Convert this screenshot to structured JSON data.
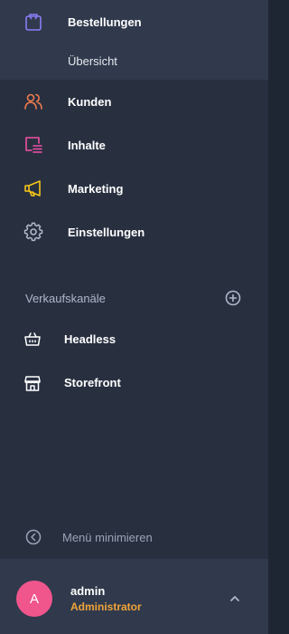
{
  "nav": {
    "orders": {
      "label": "Bestellungen",
      "icon": "shopping-bag-icon",
      "color": "#8b7cf6"
    },
    "orders_overview": {
      "label": "Übersicht"
    },
    "customers": {
      "label": "Kunden",
      "icon": "users-icon",
      "color": "#f07a4c"
    },
    "content": {
      "label": "Inhalte",
      "icon": "content-list-icon",
      "color": "#f050a5"
    },
    "marketing": {
      "label": "Marketing",
      "icon": "megaphone-icon",
      "color": "#f5c518"
    },
    "settings": {
      "label": "Einstellungen",
      "icon": "gear-icon",
      "color": "#b0b8c8"
    }
  },
  "sales_channels": {
    "title": "Verkaufskanäle",
    "items": [
      {
        "label": "Headless",
        "icon": "basket-icon"
      },
      {
        "label": "Storefront",
        "icon": "storefront-icon"
      }
    ]
  },
  "footer": {
    "collapse_label": "Menü minimieren",
    "user": {
      "initial": "A",
      "name": "admin",
      "role": "Administrator"
    }
  },
  "colors": {
    "background": "#283040",
    "active_bg": "#303a4c",
    "avatar": "#f0558c",
    "role": "#f0a33a"
  }
}
